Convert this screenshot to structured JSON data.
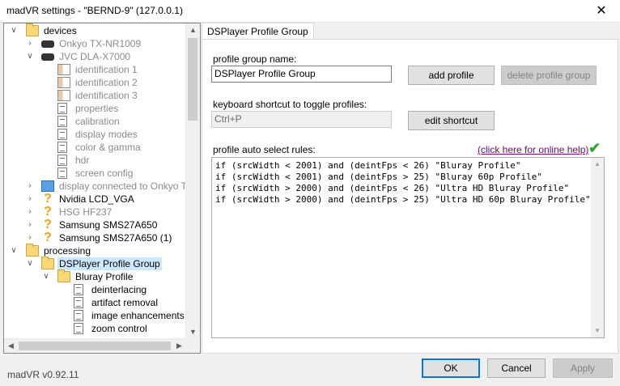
{
  "window": {
    "title": "madVR settings - \"BERND-9\" (127.0.0.1)",
    "close_glyph": "✕"
  },
  "tree": {
    "items": [
      {
        "label": "devices",
        "icon": "folder",
        "expander": "∨"
      },
      {
        "label": "Onkyo TX-NR1009",
        "icon": "receiver",
        "expander": "›"
      },
      {
        "label": "JVC DLA-X7000",
        "icon": "projector",
        "expander": "∨"
      },
      {
        "label": "identification 1",
        "icon": "id-card"
      },
      {
        "label": "identification 2",
        "icon": "id-card"
      },
      {
        "label": "identification 3",
        "icon": "id-card"
      },
      {
        "label": "properties",
        "icon": "document"
      },
      {
        "label": "calibration",
        "icon": "document"
      },
      {
        "label": "display modes",
        "icon": "document"
      },
      {
        "label": "color & gamma",
        "icon": "document"
      },
      {
        "label": "hdr",
        "icon": "document"
      },
      {
        "label": "screen config",
        "icon": "document"
      },
      {
        "label": "display connected to Onkyo TX-N",
        "icon": "monitor",
        "expander": "›"
      },
      {
        "label": "Nvidia LCD_VGA",
        "icon": "question",
        "expander": "›"
      },
      {
        "label": "HSG HF237",
        "icon": "question",
        "expander": "›"
      },
      {
        "label": "Samsung SMS27A650",
        "icon": "question",
        "expander": "›"
      },
      {
        "label": "Samsung SMS27A650 (1)",
        "icon": "question",
        "expander": "›"
      },
      {
        "label": "processing",
        "icon": "folder",
        "expander": "∨"
      },
      {
        "label": "DSPlayer Profile Group",
        "icon": "folder-open",
        "expander": "∨"
      },
      {
        "label": "Bluray Profile",
        "icon": "folder",
        "expander": "∨"
      },
      {
        "label": "deinterlacing",
        "icon": "document"
      },
      {
        "label": "artifact removal",
        "icon": "document"
      },
      {
        "label": "image enhancements",
        "icon": "document"
      },
      {
        "label": "zoom control",
        "icon": "document"
      }
    ],
    "scroll_up": "▲",
    "scroll_down": "▼",
    "scroll_left": "◀",
    "scroll_right": "▶"
  },
  "tab": {
    "label": "DSPlayer Profile Group"
  },
  "form": {
    "group_name_label": "profile group name:",
    "group_name_value": "DSPlayer Profile Group",
    "add_profile": "add profile",
    "delete_profile_group": "delete profile group",
    "shortcut_label": "keyboard shortcut to toggle profiles:",
    "shortcut_value": "Ctrl+P",
    "edit_shortcut": "edit shortcut",
    "rules_label": "profile auto select rules:",
    "online_help": "(click here for online help)",
    "valid_mark": "✔",
    "rules_text": "if (srcWidth < 2001) and (deintFps < 26) \"Bluray Profile\"\nif (srcWidth < 2001) and (deintFps > 25) \"Bluray 60p Profile\"\nif (srcWidth > 2000) and (deintFps < 26) \"Ultra HD Bluray Profile\"\nif (srcWidth > 2000) and (deintFps > 25) \"Ultra HD 60p Bluray Profile\""
  },
  "footer": {
    "version": "madVR v0.92.11",
    "ok": "OK",
    "cancel": "Cancel",
    "apply": "Apply"
  },
  "colors": {
    "selection": "#cce8ff",
    "link": "#800080",
    "check": "#2fa82f",
    "default_button_border": "#0078d7"
  }
}
